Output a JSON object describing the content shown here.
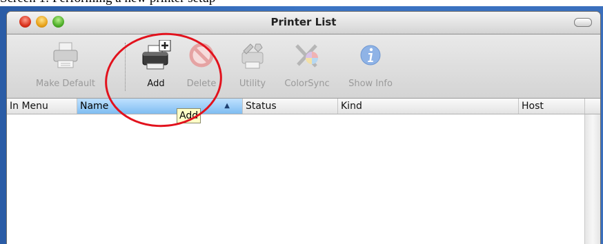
{
  "caption": "Screen 1: Performing a new printer setup",
  "window": {
    "title": "Printer List"
  },
  "toolbar": {
    "items": [
      {
        "label": "Make Default",
        "icon": "printer-default-icon",
        "enabled": false
      },
      {
        "label": "Add",
        "icon": "add-printer-icon",
        "enabled": true
      },
      {
        "label": "Delete",
        "icon": "delete-icon",
        "enabled": false
      },
      {
        "label": "Utility",
        "icon": "printer-utility-icon",
        "enabled": false
      },
      {
        "label": "ColorSync",
        "icon": "colorsync-icon",
        "enabled": false
      },
      {
        "label": "Show Info",
        "icon": "info-icon",
        "enabled": false
      }
    ]
  },
  "table": {
    "columns": [
      "In Menu",
      "Name",
      "Status",
      "Kind",
      "Host"
    ],
    "sorted_column": "Name",
    "sort_indicator": "▲",
    "rows": []
  },
  "tooltip": "Add",
  "colors": {
    "annotation": "#e2121d",
    "sorted_header": "#9fcffa",
    "tooltip_bg": "#ffffc7"
  }
}
